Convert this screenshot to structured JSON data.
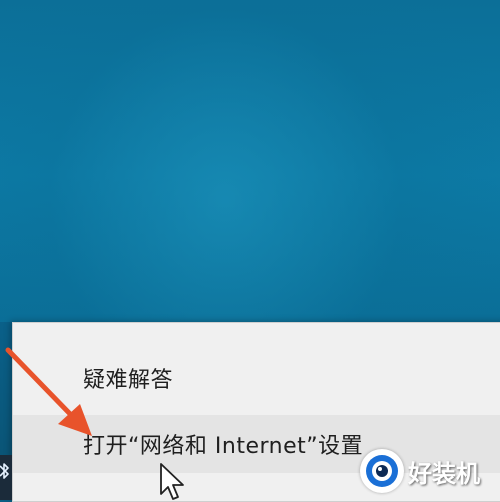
{
  "context_menu": {
    "items": [
      {
        "label": "疑难解答"
      },
      {
        "label": "打开“网络和 Internet”设置"
      }
    ]
  },
  "watermark": {
    "text": "好装机"
  },
  "icons": {
    "taskbar": "bluetooth-icon",
    "annotation": "red-arrow-icon",
    "pointer": "mouse-cursor-icon",
    "watermark_logo": "eye-logo-icon"
  },
  "colors": {
    "desktop": "#0d7aa5",
    "menu_bg": "#f0f0f0",
    "menu_hover": "#e4e4e4",
    "arrow": "#e8532b"
  }
}
